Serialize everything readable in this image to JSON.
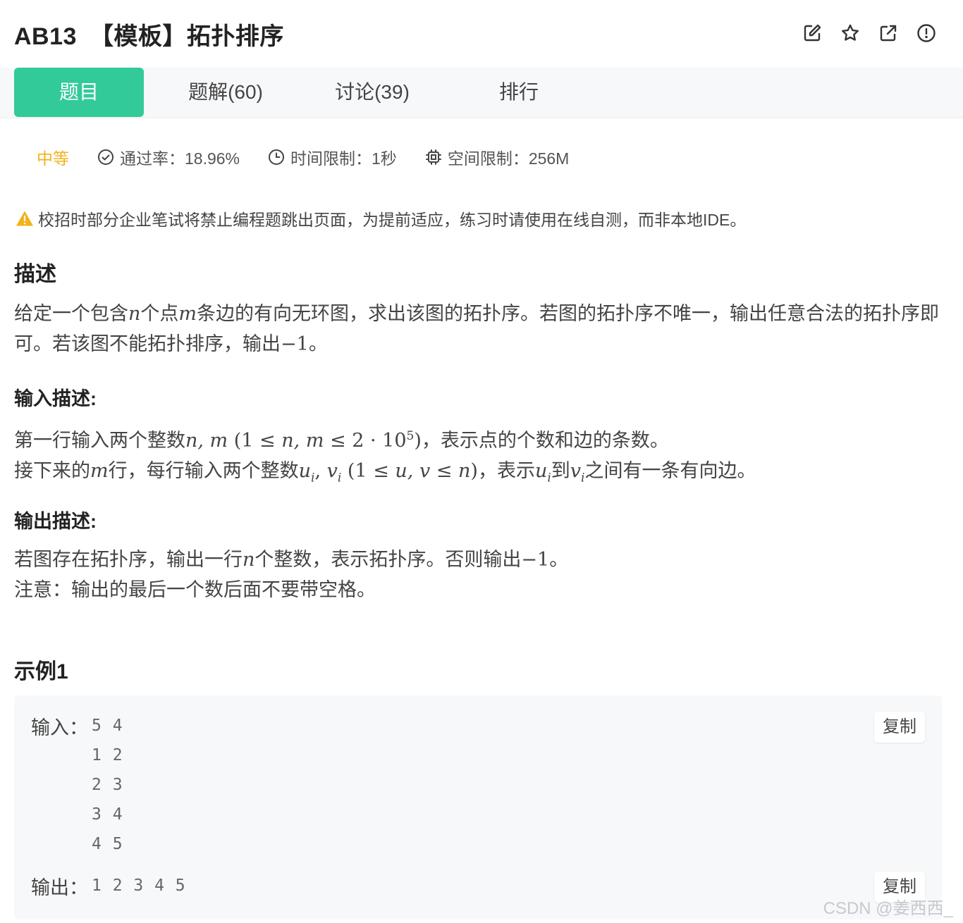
{
  "header": {
    "problem_id": "AB13",
    "problem_title": "【模板】拓扑排序",
    "icons": [
      "edit-icon",
      "star-icon",
      "external-link-icon",
      "alert-circle-icon"
    ]
  },
  "tabs": [
    {
      "label": "题目",
      "active": true
    },
    {
      "label": "题解(60)",
      "active": false
    },
    {
      "label": "讨论(39)",
      "active": false
    },
    {
      "label": "排行",
      "active": false
    }
  ],
  "meta": {
    "difficulty": "中等",
    "pass_rate": "通过率：18.96%",
    "time_limit": "时间限制：1秒",
    "memory_limit": "空间限制：256M"
  },
  "warning": "校招时部分企业笔试将禁止编程题跳出页面，为提前适应，练习时请使用在线自测，而非本地IDE。",
  "description": {
    "heading": "描述",
    "p1": "给定一个包含",
    "n": "n",
    "p2": "个点",
    "m": "m",
    "p3": "条边的有向无环图，求出该图的拓扑序。若图的拓扑序不唯一，输出任意合法的拓扑序即可。若该图不能拓扑排序，输出",
    "neg1": "−1",
    "end": "。"
  },
  "input_desc": {
    "heading": "输入描述:",
    "l1_a": "第一行输入两个整数",
    "l1_vars": "n, m",
    "l1_paren_open": " (",
    "l1_range_a": "1 ≤ ",
    "l1_range_vars": "n, m",
    "l1_range_b": " ≤ 2 · 10",
    "l1_exp": "5",
    "l1_paren_close": ")",
    "l1_b": "，表示点的个数和边的条数。",
    "l2_a": "接下来的",
    "l2_m": "m",
    "l2_b": "行，每行输入两个整数",
    "l2_u": "u",
    "l2_v": "v",
    "sub_i": "i",
    "comma": ", ",
    "l2_range_a": " (1 ≤ ",
    "l2_range_vars": "u, v",
    "l2_range_b": " ≤ ",
    "l2_range_n": "n",
    "l2_range_c": ")",
    "l2_c": "，表示",
    "l2_d": "到",
    "l2_e": "之间有一条有向边。"
  },
  "output_desc": {
    "heading": "输出描述:",
    "l1_a": "若图存在拓扑序，输出一行",
    "l1_n": "n",
    "l1_b": "个整数，表示拓扑序。否则输出",
    "l1_neg1": "−1",
    "l1_end": "。",
    "l2": "注意：输出的最后一个数后面不要带空格。"
  },
  "example": {
    "heading": "示例1",
    "input_label": "输入：",
    "input_lines": [
      "5 4",
      "1 2",
      "2 3",
      "3 4",
      "4 5"
    ],
    "output_label": "输出：",
    "output_value": "1 2 3 4 5",
    "copy_label": "复制"
  },
  "watermark": "CSDN @姜西西_",
  "colors": {
    "accent": "#32ca99",
    "difficulty": "#f2b21a",
    "warning": "#f2b21a"
  }
}
